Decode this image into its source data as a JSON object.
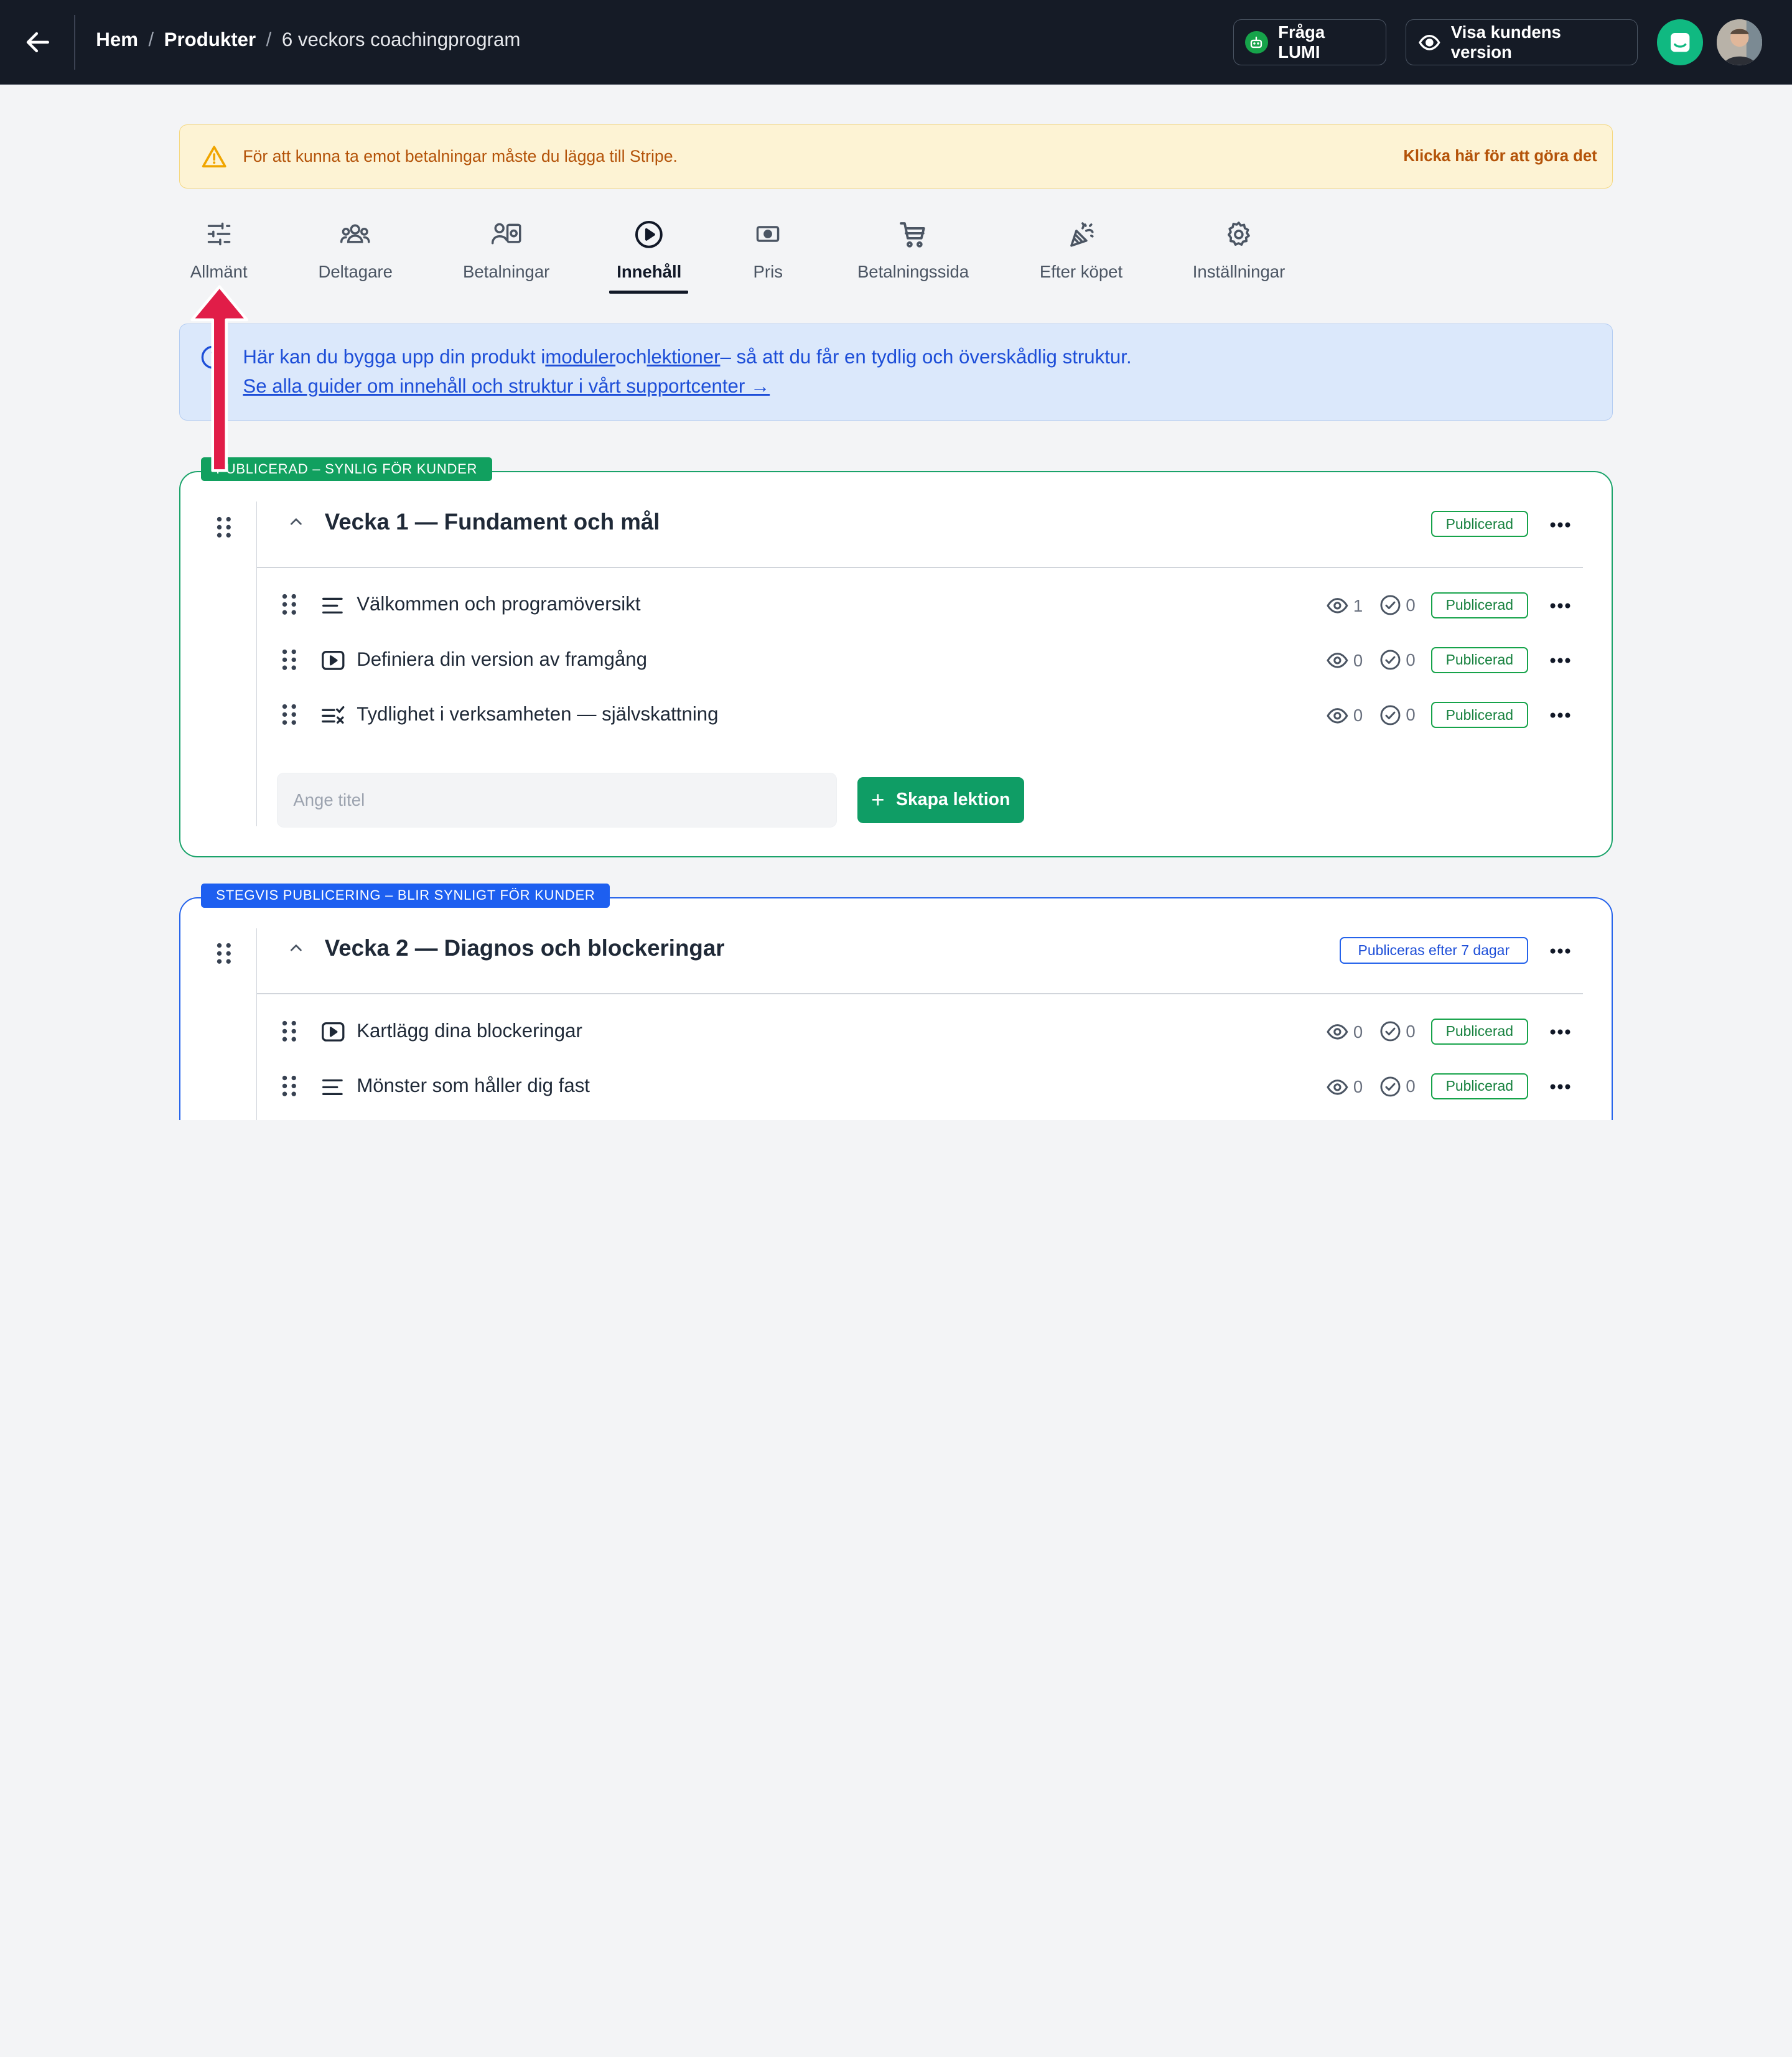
{
  "topbar": {
    "breadcrumb": {
      "home": "Hem",
      "sep": "/",
      "products": "Produkter",
      "current": "6 veckors coachingprogram"
    },
    "ask_lumi": "Fråga LUMI",
    "customer_view": "Visa kundens version"
  },
  "alert": {
    "text": "För att kunna ta emot betalningar måste du lägga till Stripe.",
    "link": "Klicka här för att göra det"
  },
  "tabs": [
    {
      "label": "Allmänt",
      "icon": "sliders-icon"
    },
    {
      "label": "Deltagare",
      "icon": "users-icon"
    },
    {
      "label": "Betalningar",
      "icon": "payments-icon"
    },
    {
      "label": "Innehåll",
      "icon": "play-circle-icon",
      "active": true
    },
    {
      "label": "Pris",
      "icon": "banknote-icon"
    },
    {
      "label": "Betalningssida",
      "icon": "cart-icon"
    },
    {
      "label": "Efter köpet",
      "icon": "party-popper-icon"
    },
    {
      "label": "Inställningar",
      "icon": "gear-icon"
    }
  ],
  "info": {
    "line1_pre": "Här kan du bygga upp din produkt i",
    "line1_link1": "moduler",
    "line1_mid": "och",
    "line1_link2": "lektioner",
    "line1_post": "– så att du får en tydlig och överskådlig struktur.",
    "line2_link": "Se alla guider om innehåll och struktur i vårt supportcenter →"
  },
  "modules": [
    {
      "tag": "PUBLICERAD – SYNLIG FÖR KUNDER",
      "tag_color": "#11a05f",
      "title": "Vecka 1 — Fundament och mål",
      "status": "Publicerad",
      "lessons": [
        {
          "type_icon": "text-lines-icon",
          "title": "Välkommen och programöversikt",
          "views": "1",
          "completed": "0",
          "status": "Publicerad"
        },
        {
          "type_icon": "video-icon",
          "title": "Definiera din version av framgång",
          "views": "0",
          "completed": "0",
          "status": "Publicerad"
        },
        {
          "type_icon": "quiz-icon",
          "title": "Tydlighet i verksamheten — självskattning",
          "views": "0",
          "completed": "0",
          "status": "Publicerad"
        }
      ],
      "new_lesson": {
        "placeholder": "Ange titel",
        "button": "Skapa lektion"
      }
    },
    {
      "tag": "STEGVIS PUBLICERING – BLIR SYNLIGT FÖR KUNDER",
      "tag_color": "#1d5ff0",
      "title": "Vecka 2 — Diagnos och blockeringar",
      "status": "Publiceras efter 7 dagar",
      "lessons": [
        {
          "type_icon": "video-icon",
          "title": "Kartlägg dina blockeringar",
          "views": "0",
          "completed": "0",
          "status": "Publicerad"
        },
        {
          "type_icon": "text-lines-icon",
          "title": "Mönster som håller dig fast",
          "views": "0",
          "completed": "0",
          "status": "Publicerad"
        }
      ]
    }
  ],
  "colors": {
    "topbar": "#151b26",
    "accent_green": "#0f9d65",
    "accent_blue": "#1d5ff0",
    "annotation_arrow": "#e11d48"
  }
}
